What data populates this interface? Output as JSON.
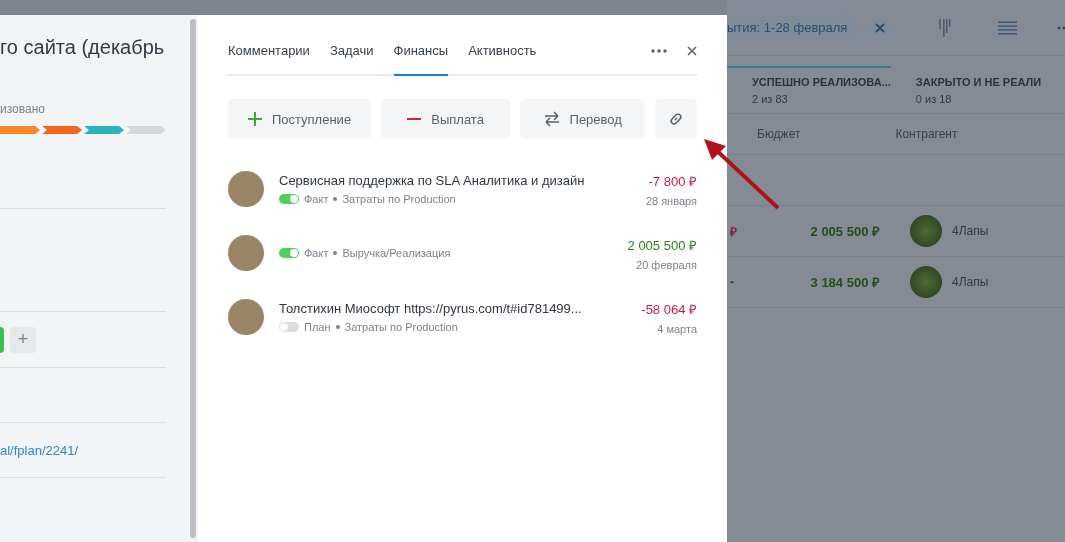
{
  "left_panel": {
    "title": "го сайта (декабрь",
    "stage_label": "изовано",
    "stages": [
      {
        "color": "#f7862a"
      },
      {
        "color": "#f26624"
      },
      {
        "color": "#2ab3bf"
      },
      {
        "color": "#d5d9de"
      }
    ],
    "add_button": "+",
    "link": "al/fplan/2241/"
  },
  "finance_panel": {
    "tabs": [
      {
        "label": "Комментарии",
        "selected": false
      },
      {
        "label": "Задачи",
        "selected": false
      },
      {
        "label": "Финансы",
        "selected": true
      },
      {
        "label": "Активность",
        "selected": false
      }
    ],
    "actions": [
      {
        "kind": "income",
        "label": "Поступление"
      },
      {
        "kind": "payout",
        "label": "Выплата"
      },
      {
        "kind": "transfer",
        "label": "Перевод"
      },
      {
        "kind": "link"
      }
    ],
    "transactions": [
      {
        "title": "Сервисная поддержка по SLA Аналитика и дизайн",
        "on": true,
        "status": "Факт",
        "category": "Затраты по Production",
        "amount": "-7 800 ₽",
        "color": "#c51d4a",
        "date": "28 января"
      },
      {
        "on": true,
        "status": "Факт",
        "category": "Выручка/Реализация",
        "amount": "2 005 500 ₽",
        "color": "#2f7d1f",
        "date": "20 февраля"
      },
      {
        "title": "Толстихин Миософт https://pyrus.com/t#id781499...",
        "on": false,
        "status": "План",
        "category": "Затраты по Production",
        "amount": "-58 064 ₽",
        "color": "#c51d4a",
        "date": "4 марта"
      }
    ]
  },
  "background": {
    "filter_chip": "ытия: 1-28 февраля",
    "stages": [
      {
        "name": "УСПЕШНО РЕАЛИЗОВА...",
        "count": "2 из 83",
        "selected": true
      },
      {
        "name": "ЗАКРЫТО И НЕ РЕАЛИ",
        "count": "0 из 18",
        "selected": false
      }
    ],
    "columns": [
      "Бюджет",
      "Контрагент"
    ],
    "rows": [
      {
        "column_1": "₽",
        "budget": "2 005 500 ₽",
        "counterparty": "4Лапы"
      },
      {
        "column_1": "-",
        "budget": "3 184 500 ₽",
        "counterparty": "4Лапы"
      }
    ]
  }
}
